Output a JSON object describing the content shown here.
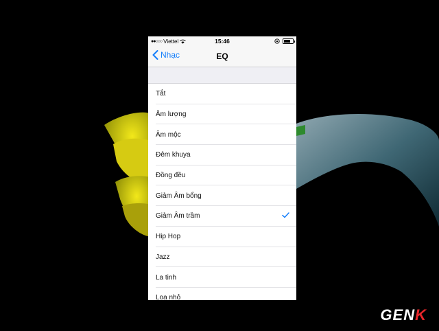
{
  "status_bar": {
    "carrier": "Viettel",
    "time": "15:46",
    "signal_icon": "signal-dots-icon",
    "wifi_icon": "wifi-icon",
    "lock_icon": "rotation-lock-icon",
    "battery_icon": "battery-icon"
  },
  "nav": {
    "back_label": "Nhạc",
    "title": "EQ"
  },
  "eq_options": [
    {
      "label": "Tắt",
      "selected": false
    },
    {
      "label": "Âm lượng",
      "selected": false
    },
    {
      "label": "Âm mộc",
      "selected": false
    },
    {
      "label": "Đêm khuya",
      "selected": false
    },
    {
      "label": "Đồng đều",
      "selected": false
    },
    {
      "label": "Giảm Âm bổng",
      "selected": false
    },
    {
      "label": "Giảm Âm trầm",
      "selected": true
    },
    {
      "label": "Hip Hop",
      "selected": false
    },
    {
      "label": "Jazz",
      "selected": false
    },
    {
      "label": "La tinh",
      "selected": false
    },
    {
      "label": "Loa nhỏ",
      "selected": false
    }
  ],
  "watermark": {
    "main": "GEN",
    "accent": "K"
  },
  "colors": {
    "accent": "#147efb",
    "background": "#000000",
    "list_bg": "#ffffff",
    "group_bg": "#efeff4"
  }
}
